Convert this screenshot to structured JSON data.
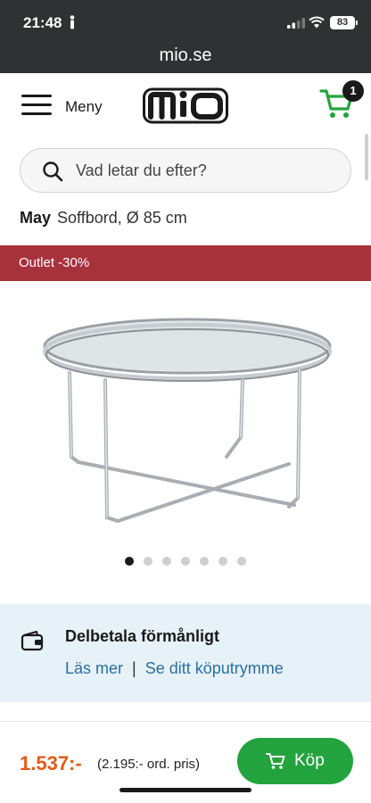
{
  "status": {
    "time": "21:48",
    "battery": "83"
  },
  "browser": {
    "url": "mio.se"
  },
  "header": {
    "menu_label": "Meny",
    "logo_alt": "mio",
    "cart_count": "1"
  },
  "search": {
    "placeholder": "Vad letar du efter?"
  },
  "product": {
    "name": "May",
    "subtitle": "Soffbord, Ø 85 cm",
    "badge": "Outlet -30%",
    "image_count": 7,
    "active_image": 0
  },
  "finance": {
    "title": "Delbetala förmånligt",
    "link_more": "Läs mer",
    "separator": "|",
    "link_space": "Se ditt köputrymme"
  },
  "purchase": {
    "price": "1.537:-",
    "ordinary_price": "(2.195:- ord. pris)",
    "buy_label": "Köp"
  },
  "colors": {
    "accent_green": "#23a33d",
    "outlet_red": "#a8323c",
    "price_orange": "#e55a14",
    "link_blue": "#2a6fa0"
  }
}
